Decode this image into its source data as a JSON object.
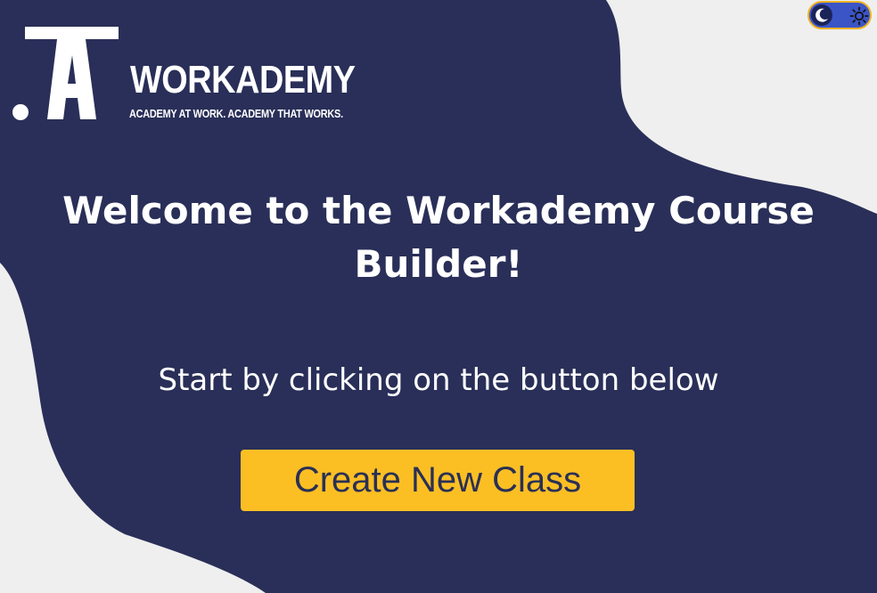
{
  "brand": {
    "name": "WORKADEMY",
    "tagline": "ACADEMY AT WORK. ACADEMY THAT WORKS."
  },
  "theme_toggle": {
    "left_icon": "moon-icon",
    "right_icon": "sun-icon"
  },
  "main": {
    "title": "Welcome to the Workademy Course Builder!",
    "subtitle": "Start by clicking on the button below",
    "create_button_label": "Create New Class"
  },
  "colors": {
    "navy": "#292f58",
    "page_background": "#efefef",
    "accent_yellow": "#fbbf24",
    "button_text": "#2a3054",
    "toggle_blue": "#3b55c7",
    "toggle_border": "#f0b21f"
  }
}
